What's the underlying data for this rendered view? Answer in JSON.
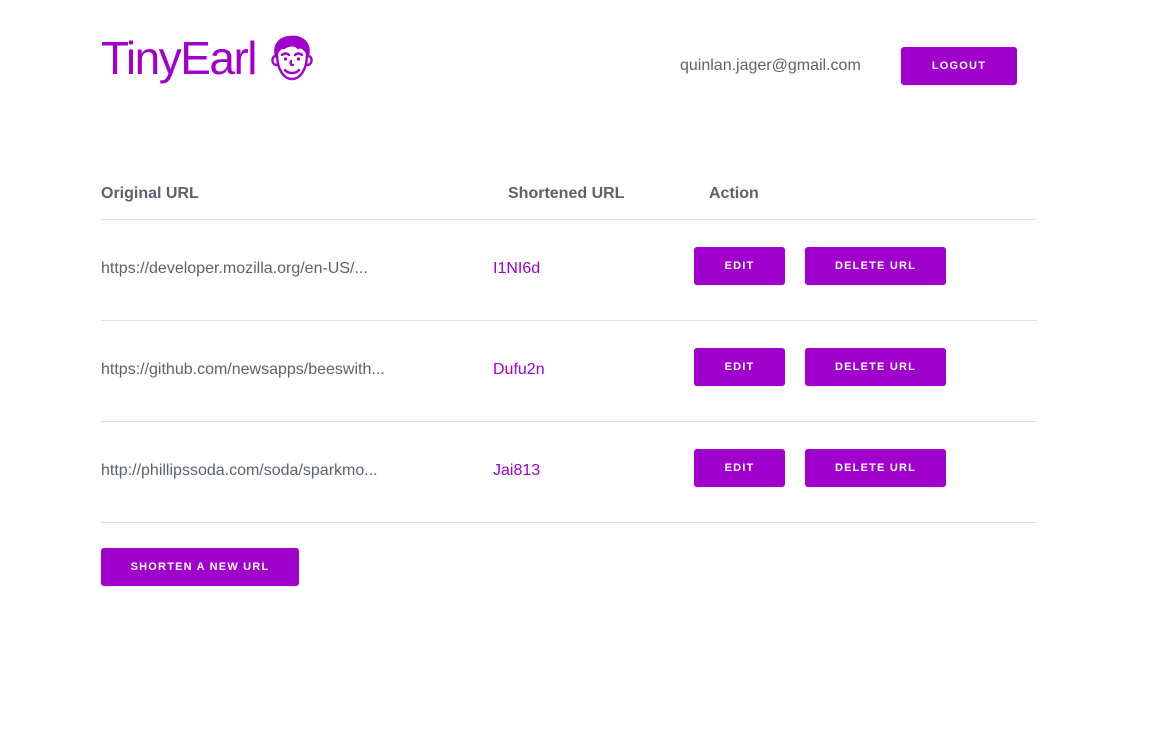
{
  "header": {
    "brand_name": "TinyEarl",
    "logo_icon": "boy-face-icon",
    "user_email": "quinlan.jager@gmail.com",
    "logout_label": "LOGOUT"
  },
  "table": {
    "headers": {
      "original": "Original URL",
      "shortened": "Shortened URL",
      "action": "Action"
    },
    "rows": [
      {
        "original": "https://developer.mozilla.org/en-US/...",
        "short": "I1NI6d",
        "edit_label": "EDIT",
        "delete_label": "DELETE URL"
      },
      {
        "original": "https://github.com/newsapps/beeswith...",
        "short": "Dufu2n",
        "edit_label": "EDIT",
        "delete_label": "DELETE URL"
      },
      {
        "original": "http://phillipssoda.com/soda/sparkmo...",
        "short": "Jai813",
        "edit_label": "EDIT",
        "delete_label": "DELETE URL"
      }
    ]
  },
  "actions": {
    "shorten_label": "SHORTEN A NEW URL"
  },
  "colors": {
    "accent": "#a000cc",
    "text_muted": "#5a6270",
    "divider": "#e0e0e4"
  }
}
